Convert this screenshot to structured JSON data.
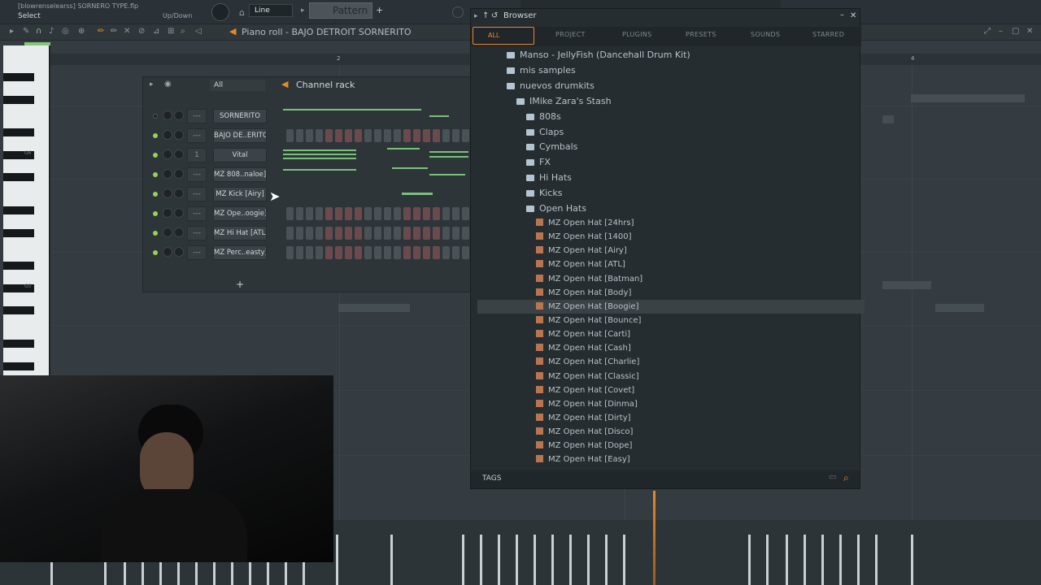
{
  "topbar": {
    "project_file": "[blowrenselearss] SORNERO TYPE.flp",
    "mode": "Select",
    "updown": "Up/Down",
    "line_mode": "Line",
    "pattern": "Pattern 1"
  },
  "piano_roll": {
    "title": "Piano roll - BAJO DETROIT SORNERITO",
    "bar_markers": [
      "2",
      "4"
    ],
    "key_labels": [
      "G6",
      "G5"
    ]
  },
  "channel_rack": {
    "filter": "All",
    "title": "Channel rack",
    "add_label": "+",
    "channels": [
      {
        "name": "SORNERITO",
        "mixer": "---"
      },
      {
        "name": "BAJO DE..ERITO",
        "mixer": "---"
      },
      {
        "name": "Vital",
        "mixer": "1"
      },
      {
        "name": "MZ 808..naloe]",
        "mixer": "---"
      },
      {
        "name": "MZ Kick [Airy]",
        "mixer": "---"
      },
      {
        "name": "MZ Ope..oogie]",
        "mixer": "---"
      },
      {
        "name": "MZ Hi Hat [ATL]",
        "mixer": "---"
      },
      {
        "name": "MZ Perc..easty]",
        "mixer": "---"
      }
    ]
  },
  "browser": {
    "title": "Browser",
    "tabs": [
      "ALL",
      "PROJECT",
      "PLUGINS",
      "PRESETS",
      "SOUNDS",
      "STARRED"
    ],
    "folders": [
      {
        "label": "Manso - JellyFish (Dancehall Drum Kit)",
        "level": 0
      },
      {
        "label": "mis samples",
        "level": 0
      },
      {
        "label": "nuevos drumkits",
        "level": 0
      },
      {
        "label": "IMike Zara's Stash",
        "level": 1
      },
      {
        "label": "808s",
        "level": 2
      },
      {
        "label": "Claps",
        "level": 2
      },
      {
        "label": "Cymbals",
        "level": 2
      },
      {
        "label": "FX",
        "level": 2
      },
      {
        "label": "Hi Hats",
        "level": 2
      },
      {
        "label": "Kicks",
        "level": 2
      },
      {
        "label": "Open Hats",
        "level": 2
      }
    ],
    "files": [
      "MZ Open Hat [24hrs]",
      "MZ Open Hat [1400]",
      "MZ Open Hat [Airy]",
      "MZ Open Hat [ATL]",
      "MZ Open Hat [Batman]",
      "MZ Open Hat [Body]",
      "MZ Open Hat [Boogie]",
      "MZ Open Hat [Bounce]",
      "MZ Open Hat [Carti]",
      "MZ Open Hat [Cash]",
      "MZ Open Hat [Charlie]",
      "MZ Open Hat [Classic]",
      "MZ Open Hat [Covet]",
      "MZ Open Hat [Dinma]",
      "MZ Open Hat [Dirty]",
      "MZ Open Hat [Disco]",
      "MZ Open Hat [Dope]",
      "MZ Open Hat [Easy]"
    ],
    "selected_file": "MZ Open Hat [Boogie]",
    "tags_label": "TAGS"
  },
  "colors": {
    "accent_orange": "#e8882a",
    "led_green": "#9ad05a",
    "folder_icon": "#b4c4d2",
    "file_icon": "#b97550"
  }
}
